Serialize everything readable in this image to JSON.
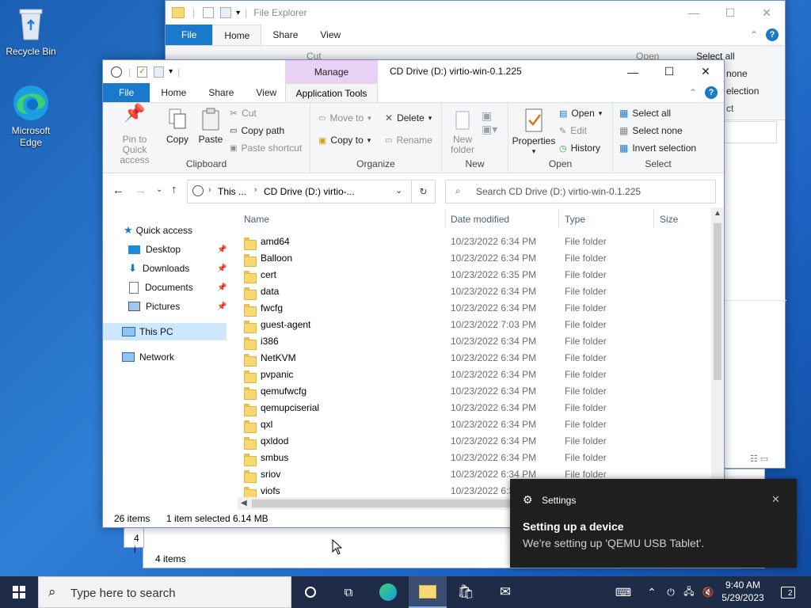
{
  "desktop": {
    "icons": [
      {
        "label": "Recycle Bin"
      },
      {
        "label": "Microsoft Edge"
      }
    ]
  },
  "back_window": {
    "title": "File Explorer",
    "tabs": [
      "File",
      "Home",
      "Share",
      "View"
    ],
    "ribbon_fragments": [
      "Cut",
      "Open",
      "Select all",
      "none",
      "election",
      "ct"
    ],
    "status": "4 items",
    "status_left": "4 i"
  },
  "front_window": {
    "title": "CD Drive (D:) virtio-win-0.1.225",
    "manage_tab": "Manage",
    "app_tools_tab": "Application Tools",
    "tabs": [
      "File",
      "Home",
      "Share",
      "View"
    ],
    "ribbon": {
      "clipboard": {
        "label": "Clipboard",
        "pin": "Pin to Quick access",
        "copy": "Copy",
        "paste": "Paste",
        "cut": "Cut",
        "copy_path": "Copy path",
        "paste_shortcut": "Paste shortcut"
      },
      "organize": {
        "label": "Organize",
        "move_to": "Move to",
        "copy_to": "Copy to",
        "delete": "Delete",
        "rename": "Rename"
      },
      "new": {
        "label": "New",
        "new_folder": "New folder"
      },
      "open": {
        "label": "Open",
        "properties": "Properties",
        "open": "Open",
        "edit": "Edit",
        "history": "History"
      },
      "select": {
        "label": "Select",
        "select_all": "Select all",
        "select_none": "Select none",
        "invert": "Invert selection"
      }
    },
    "address": {
      "crumb1": "This ...",
      "crumb2": "CD Drive (D:) virtio-...",
      "search_placeholder": "Search CD Drive (D:) virtio-win-0.1.225"
    },
    "nav": {
      "quick_access": "Quick access",
      "desktop": "Desktop",
      "downloads": "Downloads",
      "documents": "Documents",
      "pictures": "Pictures",
      "this_pc": "This PC",
      "network": "Network"
    },
    "columns": {
      "name": "Name",
      "date": "Date modified",
      "type": "Type",
      "size": "Size"
    },
    "files": [
      {
        "name": "amd64",
        "date": "10/23/2022 6:34 PM",
        "type": "File folder"
      },
      {
        "name": "Balloon",
        "date": "10/23/2022 6:34 PM",
        "type": "File folder"
      },
      {
        "name": "cert",
        "date": "10/23/2022 6:35 PM",
        "type": "File folder"
      },
      {
        "name": "data",
        "date": "10/23/2022 6:34 PM",
        "type": "File folder"
      },
      {
        "name": "fwcfg",
        "date": "10/23/2022 6:34 PM",
        "type": "File folder"
      },
      {
        "name": "guest-agent",
        "date": "10/23/2022 7:03 PM",
        "type": "File folder"
      },
      {
        "name": "i386",
        "date": "10/23/2022 6:34 PM",
        "type": "File folder"
      },
      {
        "name": "NetKVM",
        "date": "10/23/2022 6:34 PM",
        "type": "File folder"
      },
      {
        "name": "pvpanic",
        "date": "10/23/2022 6:34 PM",
        "type": "File folder"
      },
      {
        "name": "qemufwcfg",
        "date": "10/23/2022 6:34 PM",
        "type": "File folder"
      },
      {
        "name": "qemupciserial",
        "date": "10/23/2022 6:34 PM",
        "type": "File folder"
      },
      {
        "name": "qxl",
        "date": "10/23/2022 6:34 PM",
        "type": "File folder"
      },
      {
        "name": "qxldod",
        "date": "10/23/2022 6:34 PM",
        "type": "File folder"
      },
      {
        "name": "smbus",
        "date": "10/23/2022 6:34 PM",
        "type": "File folder"
      },
      {
        "name": "sriov",
        "date": "10/23/2022 6:34 PM",
        "type": "File folder"
      },
      {
        "name": "viofs",
        "date": "10/23/2022 6:3",
        "type": "File folder"
      }
    ],
    "status": {
      "items": "26 items",
      "selected": "1 item selected",
      "size": "6.14 MB"
    }
  },
  "toast": {
    "app": "Settings",
    "title": "Setting up a device",
    "body": "We're setting up 'QEMU USB Tablet'."
  },
  "taskbar": {
    "search_placeholder": "Type here to search",
    "time": "9:40 AM",
    "date": "5/29/2023",
    "notifications": "2"
  },
  "colors": {
    "accent": "#1979ca",
    "manage": "#e8d1f5",
    "taskbar": "#1e2c48"
  }
}
